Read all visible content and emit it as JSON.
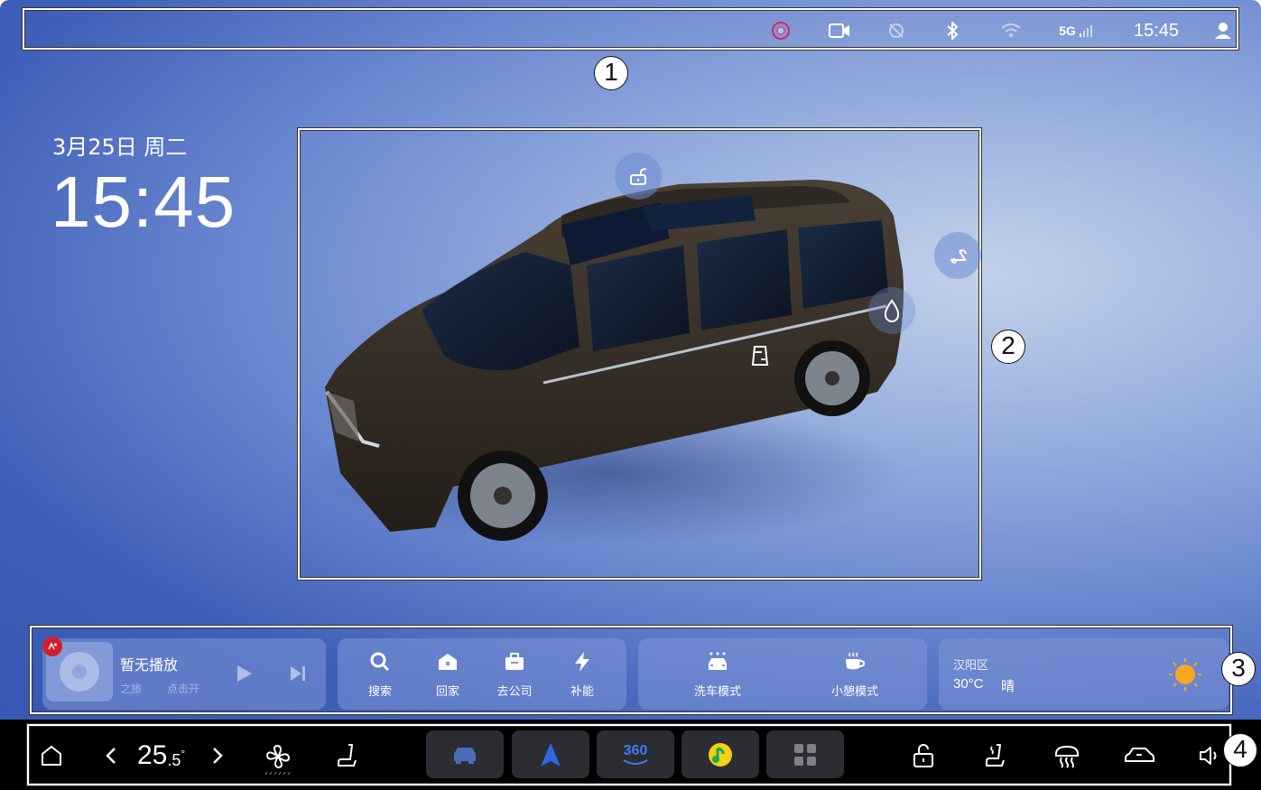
{
  "status_bar": {
    "network": "5G",
    "time": "15:45",
    "icons": [
      "record-icon",
      "video-camera-icon",
      "location-off-icon",
      "bluetooth-icon",
      "wifi-icon",
      "cellular-signal-icon",
      "user-icon"
    ]
  },
  "home": {
    "date": "3月25日 周二",
    "time": "15:45"
  },
  "car": {
    "controls": [
      "lock-icon",
      "trunk-icon",
      "washer-fluid-icon",
      "sliding-door-icon"
    ]
  },
  "media": {
    "app_icon": "music-app-icon",
    "title": "暂无播放",
    "subtitle_left": "之旅",
    "subtitle_right": "点击开"
  },
  "quick_actions": [
    {
      "label": "搜索",
      "icon": "search-icon"
    },
    {
      "label": "回家",
      "icon": "home-icon"
    },
    {
      "label": "去公司",
      "icon": "briefcase-icon"
    },
    {
      "label": "补能",
      "icon": "charge-icon"
    }
  ],
  "modes": [
    {
      "label": "洗车模式",
      "icon": "car-wash-icon"
    },
    {
      "label": "小憩模式",
      "icon": "coffee-icon"
    }
  ],
  "weather": {
    "district": "汉阳区",
    "temp": "30°C",
    "condition": "晴",
    "icon": "sun-icon"
  },
  "dock": {
    "temperature_main": "25",
    "temperature_decimal": ".5",
    "temperature_unit": "°",
    "apps": [
      "car-model-app-icon",
      "navigation-app-icon",
      "camera-360-app-icon",
      "music-player-app-icon",
      "app-grid-icon"
    ],
    "camera_360_label": "360"
  },
  "annotations": [
    "1",
    "2",
    "3",
    "4"
  ],
  "colors": {
    "background": "#5a7ac8",
    "card": "#8aa2dc",
    "dock": "#000000",
    "tile": "#2b2d32",
    "nav_accent": "#2f66e8",
    "sun": "#f7a623"
  }
}
